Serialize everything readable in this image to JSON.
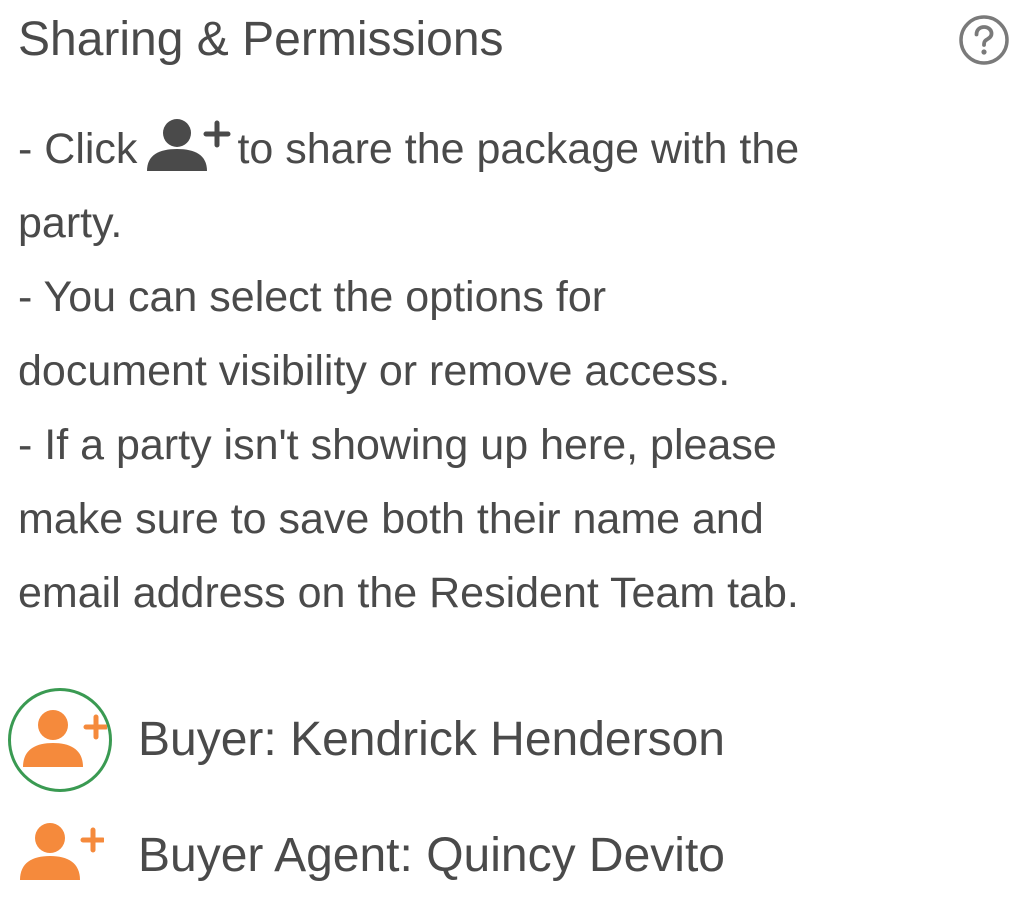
{
  "header": {
    "title": "Sharing & Permissions",
    "help_icon": "question-circle-icon"
  },
  "instructions": {
    "line1_prefix": "- Click",
    "line1_icon": "user-plus-icon",
    "line1_suffix": "to share the package with the",
    "line2": "party.",
    "line3": "- You can select the options for",
    "line4": "document visibility or remove access.",
    "line5": "- If a party isn't showing up here, please",
    "line6": "make sure to save both their name and",
    "line7": "email address on the Resident Team tab."
  },
  "parties": [
    {
      "label": "Buyer: Kendrick Henderson",
      "icon": "user-plus-icon",
      "selected": true
    },
    {
      "label": "Buyer Agent: Quincy Devito",
      "icon": "user-plus-icon",
      "selected": false
    }
  ],
  "colors": {
    "text": "#4a4a4a",
    "accent_orange": "#f58a3c",
    "icon_gray": "#4a4a4a",
    "selected_ring": "#3a9a52"
  }
}
